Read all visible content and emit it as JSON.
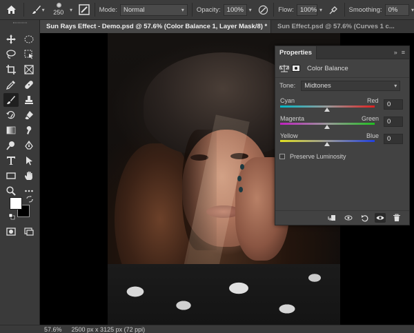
{
  "options_bar": {
    "brush_size": "250",
    "mode_label": "Mode:",
    "mode_value": "Normal",
    "opacity_label": "Opacity:",
    "opacity_value": "100%",
    "flow_label": "Flow:",
    "flow_value": "100%",
    "smoothing_label": "Smoothing:",
    "smoothing_value": "0%"
  },
  "tabs": [
    {
      "label": "Sun Rays Effect - Demo.psd @ 57.6% (Color Balance 1, Layer Mask/8) *",
      "close": "×"
    },
    {
      "label": "Sun Effect.psd @ 57.6% (Curves 1 c..."
    }
  ],
  "toolbar": {
    "tools": [
      "move-tool",
      "marquee-tool",
      "lasso-tool",
      "object-select-tool",
      "crop-tool",
      "frame-tool",
      "eyedropper-tool",
      "healing-tool",
      "brush-tool",
      "stamp-tool",
      "history-brush-tool",
      "eraser-tool",
      "gradient-tool",
      "smudge-tool",
      "dodge-tool",
      "pen-tool",
      "type-tool",
      "path-select-tool",
      "rectangle-tool",
      "hand-tool",
      "zoom-tool",
      "more-tools"
    ],
    "foreground_color": "#ffffff",
    "background_color": "#000000"
  },
  "properties": {
    "tab_title": "Properties",
    "adjustment_name": "Color Balance",
    "tone_label": "Tone:",
    "tone_value": "Midtones",
    "sliders": [
      {
        "left": "Cyan",
        "right": "Red",
        "value": "0",
        "left_color": "#00b8c8",
        "right_color": "#e02020"
      },
      {
        "left": "Magenta",
        "right": "Green",
        "value": "0",
        "left_color": "#c020c0",
        "right_color": "#20c020"
      },
      {
        "left": "Yellow",
        "right": "Blue",
        "value": "0",
        "left_color": "#e0e020",
        "right_color": "#2040e0"
      }
    ],
    "preserve_luminosity_label": "Preserve Luminosity",
    "preserve_luminosity_checked": false
  },
  "status": {
    "zoom": "57.6%",
    "doc_info": "2500 px x 3125 px (72 ppi)"
  }
}
